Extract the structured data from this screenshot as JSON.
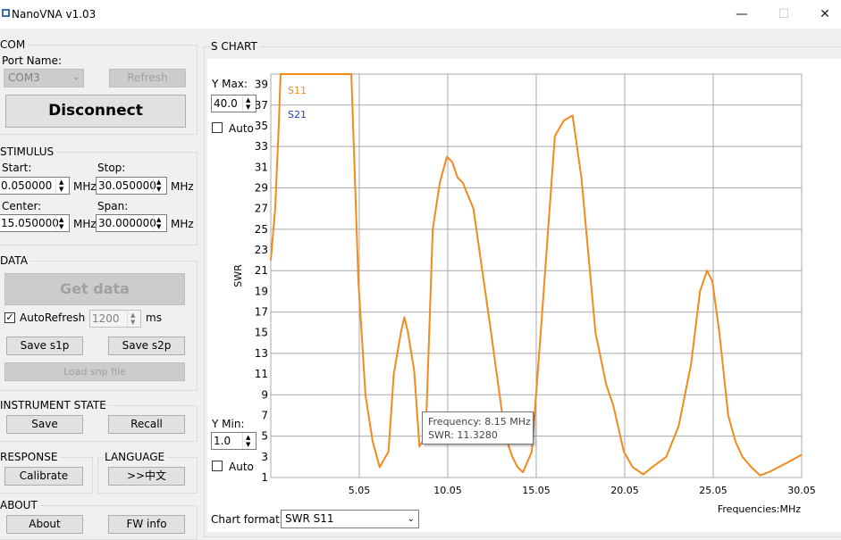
{
  "window": {
    "title": "NanoVNA v1.03"
  },
  "com": {
    "label": "COM",
    "port_label": "Port Name:",
    "port_value": "COM3",
    "refresh": "Refresh",
    "disconnect": "Disconnect"
  },
  "stimulus": {
    "label": "STIMULUS",
    "start_label": "Start:",
    "start_value": "0.050000",
    "stop_label": "Stop:",
    "stop_value": "30.050000",
    "center_label": "Center:",
    "center_value": "15.050000",
    "span_label": "Span:",
    "span_value": "30.000000",
    "unit": "MHz"
  },
  "data": {
    "label": "DATA",
    "get_data": "Get data",
    "autorefresh_label": "AutoRefresh",
    "autorefresh_checked": true,
    "interval_value": "1200",
    "interval_unit": "ms",
    "save_s1p": "Save s1p",
    "save_s2p": "Save s2p",
    "load_snp": "Load snp file"
  },
  "instrument": {
    "label": "INSTRUMENT STATE",
    "save": "Save",
    "recall": "Recall"
  },
  "response": {
    "label": "RESPONSE",
    "calibrate": "Calibrate"
  },
  "language": {
    "label": "LANGUAGE",
    "button": ">>中文"
  },
  "about": {
    "label": "ABOUT",
    "about_button": "About",
    "fw_info": "FW info"
  },
  "schart": {
    "label": "S CHART",
    "ymax_label": "Y Max:",
    "ymax_value": "40.0",
    "auto_label": "Auto",
    "ymin_label": "Y Min:",
    "ymin_value": "1.0",
    "format_label": "Chart format:",
    "format_value": "SWR S11",
    "tooltip_freq": "Frequency: 8.15 MHz",
    "tooltip_swr": "SWR: 11.3280"
  },
  "colors": {
    "s11": "#f28a1c",
    "s21": "#1f3fcf",
    "grid": "#a9a9a9"
  },
  "chart_data": {
    "type": "line",
    "xlabel": "Frequencies:MHz",
    "ylabel": "SWR",
    "xlim": [
      0.05,
      30.05
    ],
    "ylim": [
      1,
      40
    ],
    "x_ticks": [
      "5.05",
      "10.05",
      "15.05",
      "20.05",
      "25.05",
      "30.05"
    ],
    "y_ticks": [
      "1",
      "3",
      "5",
      "7",
      "9",
      "11",
      "13",
      "15",
      "17",
      "19",
      "21",
      "23",
      "25",
      "27",
      "29",
      "31",
      "33",
      "35",
      "37",
      "39"
    ],
    "legend": [
      "S11",
      "S21"
    ],
    "series": [
      {
        "name": "S11",
        "x": [
          0.05,
          0.3,
          0.5,
          0.6,
          4.6,
          5.0,
          5.4,
          5.8,
          6.2,
          6.7,
          7.0,
          7.4,
          7.6,
          7.8,
          8.15,
          8.45,
          8.8,
          9.2,
          9.6,
          10.0,
          10.3,
          10.6,
          10.9,
          11.5,
          12.5,
          13.3,
          13.7,
          14.0,
          14.3,
          14.8,
          15.3,
          16.1,
          16.6,
          17.1,
          17.6,
          18.4,
          19.0,
          19.4,
          20.0,
          20.5,
          21.1,
          21.6,
          22.4,
          23.1,
          23.8,
          24.3,
          24.7,
          25.0,
          25.4,
          25.9,
          26.3,
          26.7,
          27.2,
          27.7,
          28.3,
          29.3,
          30.05
        ],
        "y": [
          22,
          27,
          35,
          40,
          40,
          20,
          9,
          4.5,
          2,
          3.5,
          11,
          15,
          16.5,
          15,
          11.33,
          4,
          5,
          25,
          29.5,
          32,
          31.5,
          30,
          29.5,
          27,
          15,
          5,
          3,
          2,
          1.5,
          3.5,
          15,
          34,
          35.5,
          36,
          30,
          15,
          10,
          8,
          3.5,
          2,
          1.3,
          2,
          3,
          6,
          12,
          19,
          21,
          20,
          15,
          7,
          4.5,
          3,
          2,
          1.2,
          1.6,
          2.5,
          3.2
        ]
      },
      {
        "name": "S21",
        "x": [],
        "y": []
      }
    ]
  }
}
